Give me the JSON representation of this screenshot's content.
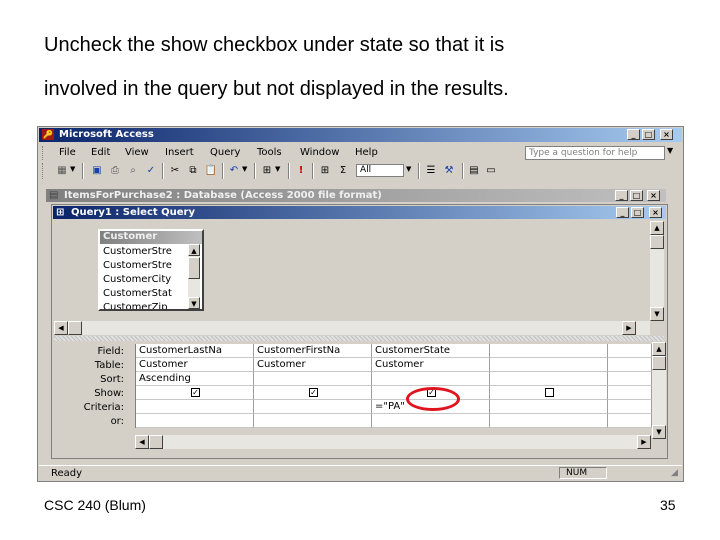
{
  "instruction": {
    "line1": "Uncheck the show checkbox under state so that it is",
    "line2": "involved in the query but not displayed in the results."
  },
  "footer": {
    "course": "CSC 240 (Blum)",
    "page_number": "35"
  },
  "app": {
    "title": "Microsoft Access",
    "menu": [
      "File",
      "Edit",
      "View",
      "Insert",
      "Query",
      "Tools",
      "Window",
      "Help"
    ],
    "help_placeholder": "Type a question for help",
    "toolbar_dropdown_value": "All"
  },
  "db_window": {
    "title": "ItemsForPurchase2 : Database (Access 2000 file format)"
  },
  "query_window": {
    "title": "Query1 : Select Query"
  },
  "field_list": {
    "title": "Customer",
    "items": [
      "CustomerStre",
      "CustomerStre",
      "CustomerCity",
      "CustomerStat",
      "CustomerZip"
    ]
  },
  "grid": {
    "row_labels": [
      "Field:",
      "Table:",
      "Sort:",
      "Show:",
      "Criteria:",
      "or:"
    ],
    "columns": [
      {
        "field": "CustomerLastNa",
        "table": "Customer",
        "sort": "Ascending",
        "show": true,
        "criteria": ""
      },
      {
        "field": "CustomerFirstNa",
        "table": "Customer",
        "sort": "",
        "show": true,
        "criteria": ""
      },
      {
        "field": "CustomerState",
        "table": "Customer",
        "sort": "",
        "show": true,
        "criteria": "=\"PA\""
      },
      {
        "field": "",
        "table": "",
        "sort": "",
        "show": false,
        "criteria": ""
      }
    ]
  },
  "status": {
    "left": "Ready",
    "right": "NUM"
  },
  "colors": {
    "title_active": "#0a246a",
    "highlight_circle": "#e0141e",
    "window_face": "#d4d0c8"
  }
}
